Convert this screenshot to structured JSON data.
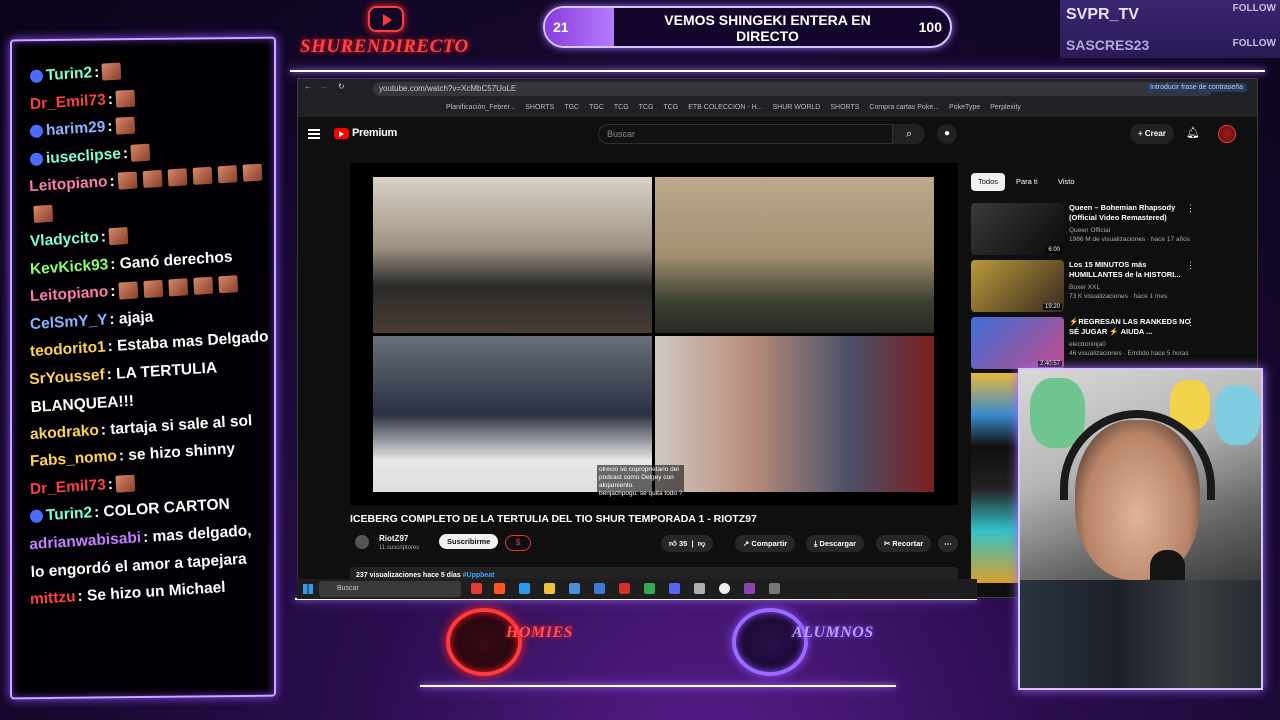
{
  "header": {
    "brand": "SHURENDIRECTO",
    "poll": {
      "left_count": "21",
      "title": "VEMOS SHINGEKI ENTERA EN DIRECTO",
      "right_count": "100",
      "fill": 0.17
    },
    "follows": [
      {
        "name": "SVPR_TV",
        "tag": "FOLLOW"
      },
      {
        "name": "SASCRES23",
        "tag": "FOLLOW"
      }
    ]
  },
  "chat": [
    {
      "user": "Turin2",
      "color": "#7fffd4",
      "text": ":",
      "emotes": 1
    },
    {
      "user": "Dr_Emil73",
      "color": "#ff4040",
      "text": ":",
      "emotes": 1
    },
    {
      "user": "harim29",
      "color": "#8ab4ff",
      "text": ":",
      "emotes": 1
    },
    {
      "user": "iuseclipse",
      "color": "#7fffd4",
      "text": ":",
      "emotes": 1
    },
    {
      "user": "Leitopiano",
      "color": "#ff7ab0",
      "text": ":",
      "emotes": 7
    },
    {
      "user": "Vladycito",
      "color": "#7fffd4",
      "text": ":",
      "emotes": 1
    },
    {
      "user": "KevKick93",
      "color": "#8cff66",
      "text": ": Ganó derechos",
      "emotes": 0
    },
    {
      "user": "Leitopiano",
      "color": "#ff7ab0",
      "text": ":",
      "emotes": 5
    },
    {
      "user": "CelSmY_Y",
      "color": "#8ab4ff",
      "text": ": ajaja",
      "emotes": 0
    },
    {
      "user": "teodorito1",
      "color": "#ffd24a",
      "text": ": Estaba mas Delgado",
      "emotes": 0
    },
    {
      "user": "SrYoussef",
      "color": "#ffd24a",
      "text": ": LA TERTULIA BLANQUEA!!!",
      "emotes": 0
    },
    {
      "user": "akodrako",
      "color": "#ffd24a",
      "text": ": tartaja si sale al sol",
      "emotes": 0
    },
    {
      "user": "Fabs_nomo",
      "color": "#ffd24a",
      "text": ": se hizo shinny",
      "emotes": 0
    },
    {
      "user": "Dr_Emil73",
      "color": "#ff4040",
      "text": ":",
      "emotes": 1
    },
    {
      "user": "Turin2",
      "color": "#7fffd4",
      "text": ": COLOR CARTON",
      "emotes": 0
    },
    {
      "user": "adrianwabisabi",
      "color": "#c77dff",
      "text": ": mas delgado, lo engordó el amor a tapejara",
      "emotes": 0
    },
    {
      "user": "mittzu",
      "color": "#ff4040",
      "text": ": Se hizo un Michael",
      "emotes": 0
    }
  ],
  "browser": {
    "url": "youtube.com/watch?v=XcMbC57UoLE",
    "password_hint": "Introducir frase de contraseña",
    "bookmarks": [
      "Planificación_Febrer...",
      "SHORTS",
      "TGC",
      "TGC",
      "TCG",
      "TCG",
      "TCG",
      "ETB COLECCION - H...",
      "SHUR WORLD",
      "SHORTS",
      "Compra cartas Poke...",
      "PokeType",
      "Perplexity"
    ]
  },
  "youtube": {
    "premium": "Premium",
    "search_placeholder": "Buscar",
    "create": "Crear",
    "video_title": "ICEBERG COMPLETO DE LA TERTULIA DEL TIO SHUR TEMPORADA 1 - RIOTZ97",
    "subtitle_lines": [
      "olrecio se coproprietario del",
      "podcast como Delgey con",
      "alojamiento.",
      "benjachpogu: se quita todo ?"
    ],
    "channel": "RiotZ97",
    "subscribers": "11 suscriptores",
    "subscribe": "Suscribirme",
    "likes": "35",
    "share": "Compartir",
    "download": "Descargar",
    "clip": "Recortar",
    "stats": "237 visualizaciones  hace 5 días",
    "hashtag": "#Uppbeat",
    "chips": [
      "Todos",
      "Para ti",
      "Visto"
    ],
    "recommendations": [
      {
        "title": "Queen – Bohemian Rhapsody (Official Video Remastered)",
        "channel": "Queen Official",
        "meta": "1986 M de visualizaciones · hace 17 años",
        "duration": "6:00"
      },
      {
        "title": "Los 15 MINUTOS más HUMILLANTES de la HISTORI...",
        "channel": "Boxer XXL",
        "meta": "73 K visualizaciones · hace 1 mes",
        "duration": "19:20"
      },
      {
        "title": "⚡REGRESAN LAS RANKEDS NO SÉ JUGAR ⚡ AIUDA ...",
        "channel": "electroninja0",
        "meta": "46 visualizaciones · Emitido hace 5 horas",
        "duration": "2:40:57"
      }
    ]
  },
  "taskbar": {
    "search": "Buscar"
  },
  "footer": {
    "left": "HOMIES",
    "right": "ALUMNOS"
  }
}
